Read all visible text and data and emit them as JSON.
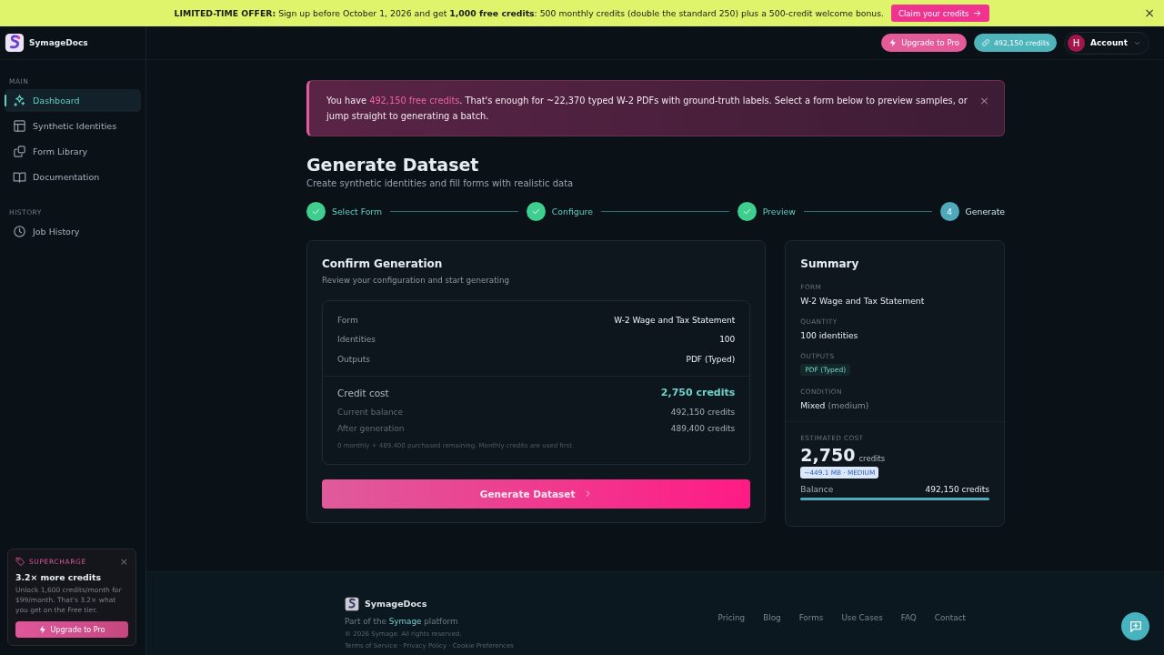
{
  "promo_banner": {
    "text": "**LIMITED-TIME OFFER:** Sign up before October 1, 2026 and get **1,000 free credits**: 500 monthly credits (double the standard 250) plus a 500-credit welcome bonus.",
    "button": "Claim your credits",
    "close": "×"
  },
  "sidebar": {
    "brand": "SymageDocs",
    "sections": [
      {
        "title": "MAIN",
        "items": [
          {
            "label": "Dashboard",
            "selected": true
          },
          {
            "label": "Synthetic Identities",
            "selected": false
          },
          {
            "label": "Form Library",
            "selected": false
          },
          {
            "label": "Documentation",
            "selected": false
          }
        ]
      },
      {
        "title": "HISTORY",
        "items": [
          {
            "label": "Job History",
            "selected": false
          }
        ]
      }
    ],
    "upsell": {
      "tag": "SUPERCHARGE",
      "close": "×",
      "title": "3.2× more credits",
      "text": "Unlock 1,600 credits/month for $99/month. That's 3.2× what you get on the Free tier.",
      "button": "Upgrade to Pro"
    }
  },
  "header": {
    "upgrade_button": "Upgrade to Pro",
    "credits_button": "492,150 credits",
    "account": {
      "initial": "H",
      "label": "Account"
    }
  },
  "notice": {
    "before": "You have ",
    "highlight": "492,150 free credits",
    "after": ". That's enough for ~22,370 typed W-2 PDFs with ground-truth labels. Select a form below to preview samples, or jump straight to generating a batch.",
    "close": "×"
  },
  "page": {
    "title": "Generate Dataset",
    "subtitle": "Create synthetic identities and fill forms with realistic data"
  },
  "steps": [
    {
      "label": "Select Form",
      "completed": true
    },
    {
      "label": "Configure",
      "completed": true
    },
    {
      "label": "Preview",
      "completed": true
    },
    {
      "label": "Generate",
      "completed": false,
      "number": "4"
    }
  ],
  "confirm": {
    "title": "Confirm Generation",
    "subtitle": "Review your configuration and start generating",
    "details": [
      {
        "label": "Form",
        "value": "W-2 Wage and Tax Statement"
      },
      {
        "label": "Identities",
        "value": "100"
      },
      {
        "label": "Outputs",
        "value": "PDF (Typed)"
      }
    ],
    "cost": {
      "label": "Credit cost",
      "value": "2,750 credits"
    },
    "balances": [
      {
        "label": "Current balance",
        "value": "492,150 credits"
      },
      {
        "label": "After generation",
        "value": "489,400 credits"
      }
    ],
    "note": "0 monthly + 489,400 purchased remaining. Monthly credits are used first.",
    "button": "Generate Dataset"
  },
  "summary": {
    "title": "Summary",
    "form_label": "FORM",
    "form": "W-2 Wage and Tax Statement",
    "quantity_label": "QUANTITY",
    "quantity": "100 identities",
    "outputs_label": "OUTPUTS",
    "outputs": [
      "PDF (Typed)"
    ],
    "condition_label": "CONDITION",
    "condition": "Mixed",
    "condition_note": "(medium)",
    "cost_label": "ESTIMATED COST",
    "cost": "2,750",
    "cost_unit": "credits",
    "size_badge": "~449.1 MB · MEDIUM",
    "balance_label": "Balance",
    "balance": "492,150 credits",
    "level": 1
  },
  "footer": {
    "brand": "SymageDocs",
    "tagline_before": "Part of the ",
    "tagline_link": "Symage",
    "tagline_after": " platform",
    "copyright": "© 2026 Symage. All rights reserved.",
    "legal": "Terms of Service · Privacy Policy · Cookie Preferences",
    "links": [
      "Pricing",
      "Blog",
      "Forms",
      "Use Cases",
      "FAQ",
      "Contact"
    ]
  }
}
